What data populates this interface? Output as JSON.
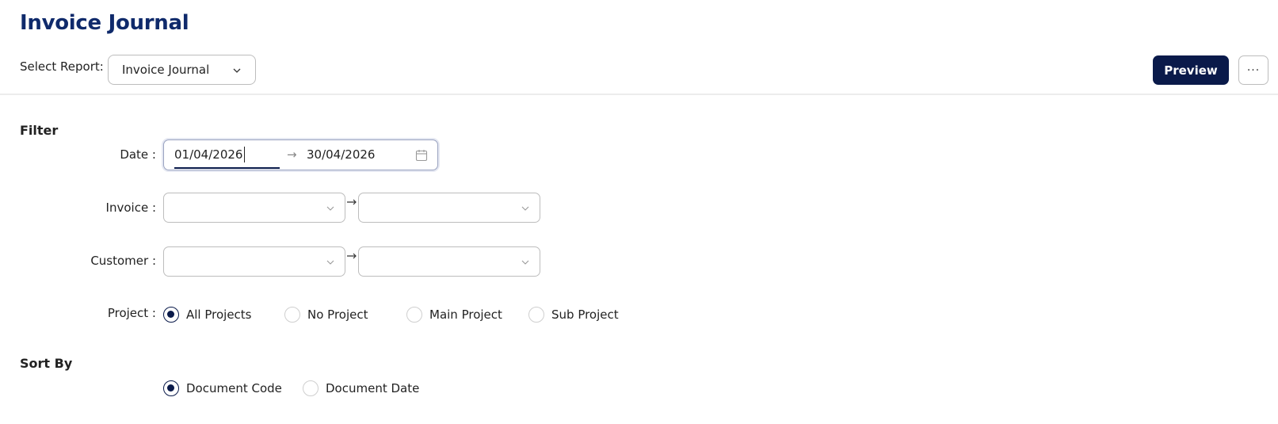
{
  "page": {
    "title": "Invoice Journal"
  },
  "report": {
    "label": "Select Report:",
    "selected": "Invoice Journal"
  },
  "toolbar": {
    "preview_label": "Preview",
    "more_label": "···"
  },
  "filter": {
    "title": "Filter",
    "date": {
      "label": "Date :",
      "from": "01/04/2026",
      "arrow": "→",
      "to": "30/04/2026"
    },
    "invoice": {
      "label": "Invoice :",
      "from": "",
      "to": ""
    },
    "customer": {
      "label": "Customer :",
      "from": "",
      "to": ""
    },
    "project": {
      "label": "Project :",
      "options": [
        "All Projects",
        "No Project",
        "Main Project",
        "Sub Project"
      ],
      "selected": "All Projects"
    }
  },
  "sort": {
    "title": "Sort By",
    "options": [
      "Document Code",
      "Document Date"
    ],
    "selected": "Document Code"
  },
  "colors": {
    "accent": "#0a1a4a",
    "title": "#0f2a6b"
  },
  "icons": [
    "chevron-down-icon",
    "calendar-icon",
    "arrow-right-icon",
    "more-icon"
  ]
}
